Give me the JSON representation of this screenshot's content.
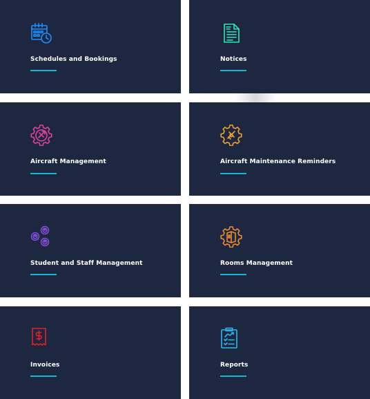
{
  "cards": [
    {
      "label": "Schedules and Bookings",
      "icon": "calendar-clock-icon",
      "color": "#1e90ff"
    },
    {
      "label": "Notices",
      "icon": "notice-document-icon",
      "color": "#2ee6b8"
    },
    {
      "label": "Aircraft Management",
      "icon": "aircraft-gear-icon",
      "color": "#e040a0"
    },
    {
      "label": "Aircraft Maintenance Reminders",
      "icon": "aircraft-maintenance-gear-icon",
      "color": "#f0a030"
    },
    {
      "label": "Student and Staff Management",
      "icon": "people-gears-icon",
      "color": "#8a4fe0"
    },
    {
      "label": "Rooms Management",
      "icon": "room-gear-icon",
      "color": "#f08a30"
    },
    {
      "label": "Invoices",
      "icon": "invoice-dollar-icon",
      "color": "#e0202a"
    },
    {
      "label": "Reports",
      "icon": "report-clipboard-icon",
      "color": "#2fb8f0"
    }
  ],
  "accent_color": "#13b8d6",
  "card_background": "#1d2840"
}
